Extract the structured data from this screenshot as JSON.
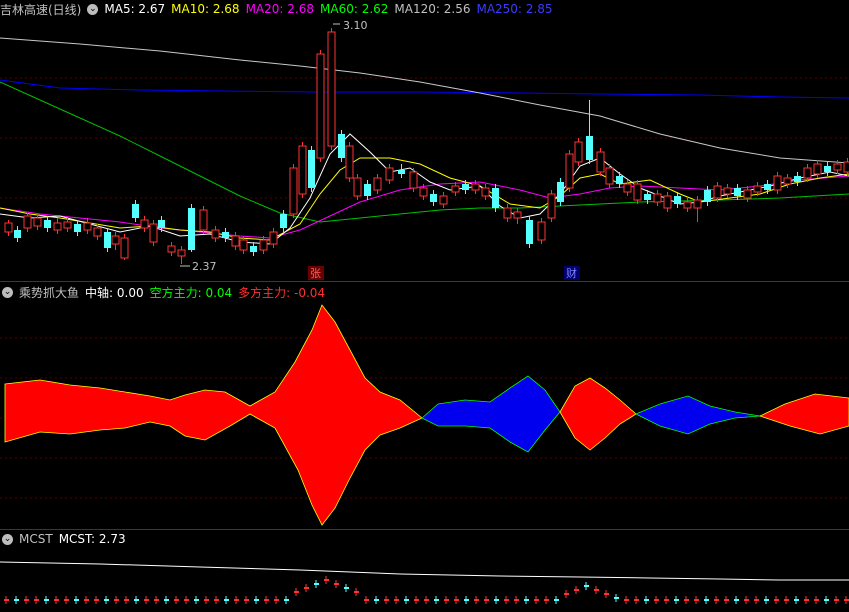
{
  "main": {
    "title": "吉林高速(日线)",
    "ma": [
      {
        "label": "MA5: 2.67",
        "color": "#ffffff"
      },
      {
        "label": "MA10: 2.68",
        "color": "#ffff00"
      },
      {
        "label": "MA20: 2.68",
        "color": "#ff00ff"
      },
      {
        "label": "MA60: 2.62",
        "color": "#00ff00"
      },
      {
        "label": "MA120: 2.56",
        "color": "#c0c0c0"
      },
      {
        "label": "MA250: 2.85",
        "color": "#0000ff"
      }
    ],
    "high_label": "3.10",
    "low_label": "2.37",
    "marker_zhang": "张",
    "marker_cai": "财"
  },
  "indicator": {
    "title": "乘势抓大鱼",
    "zhongzhou": "中轴: 0.00",
    "kongfang": "空方主力: 0.04",
    "duofang": "多方主力: -0.04"
  },
  "mcst": {
    "title": "MCST",
    "value": "MCST: 2.73"
  },
  "colors": {
    "up": "#ff3232",
    "down": "#54ffff",
    "fill_red": "#ff0000",
    "fill_blue": "#0000ee"
  }
}
